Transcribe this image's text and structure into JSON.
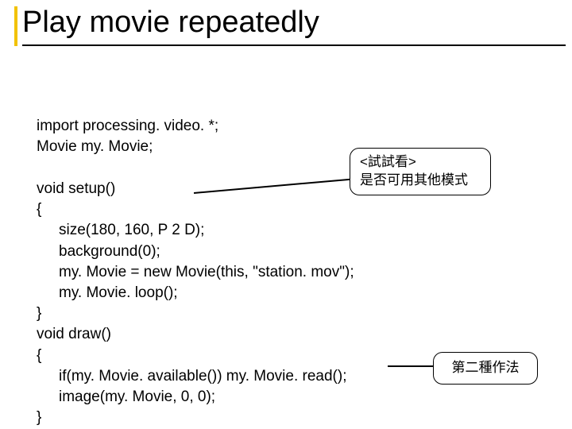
{
  "title": "Play movie repeatedly",
  "code": {
    "l1": "import processing. video. *;",
    "l2": "Movie my. Movie;",
    "blank1": " ",
    "l3": "void setup()",
    "l4": "{",
    "l5": "size(180, 160, P 2 D);",
    "l6": "background(0);",
    "l7": "my. Movie = new Movie(this, \"station. mov\");",
    "l8": "my. Movie. loop();",
    "l9": "}",
    "l10": "void draw()",
    "l11": "{",
    "l12": "if(my. Movie. available()) my. Movie. read();",
    "l13": "image(my. Movie, 0, 0);",
    "l14": "}"
  },
  "callouts": {
    "c1_line1": "<試試看>",
    "c1_line2": "是否可用其他模式",
    "c2": "第二種作法"
  }
}
